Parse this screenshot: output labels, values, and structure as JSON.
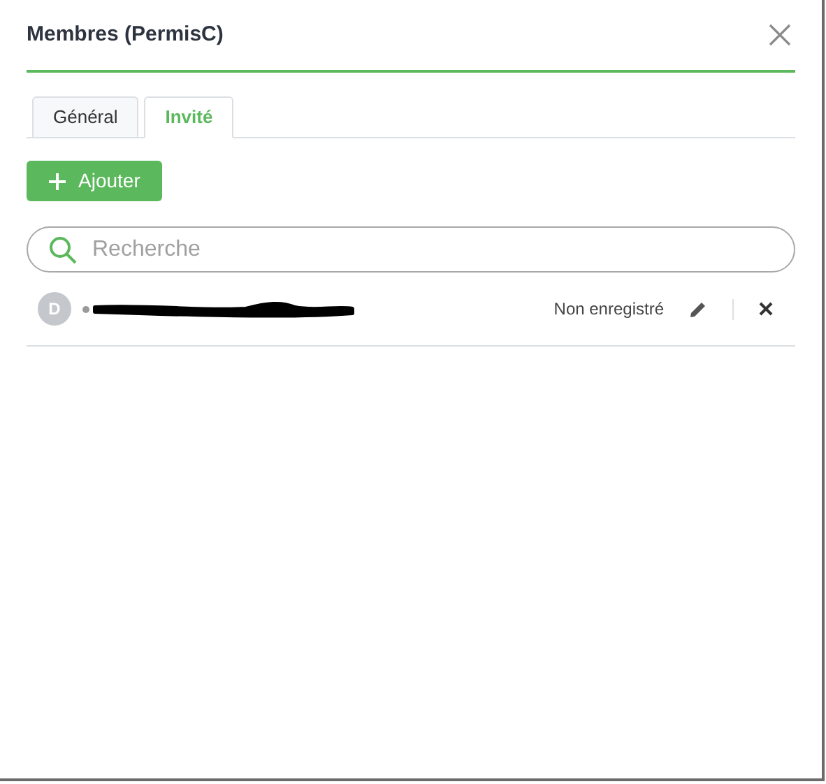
{
  "dialog": {
    "title": "Membres (PermisC)"
  },
  "tabs": [
    {
      "label": "Général",
      "selected": false
    },
    {
      "label": "Invité",
      "selected": true
    }
  ],
  "add_button": {
    "label": "Ajouter"
  },
  "search": {
    "placeholder": "Recherche"
  },
  "members": [
    {
      "initial": "D",
      "status": "Non enregistré"
    }
  ]
}
